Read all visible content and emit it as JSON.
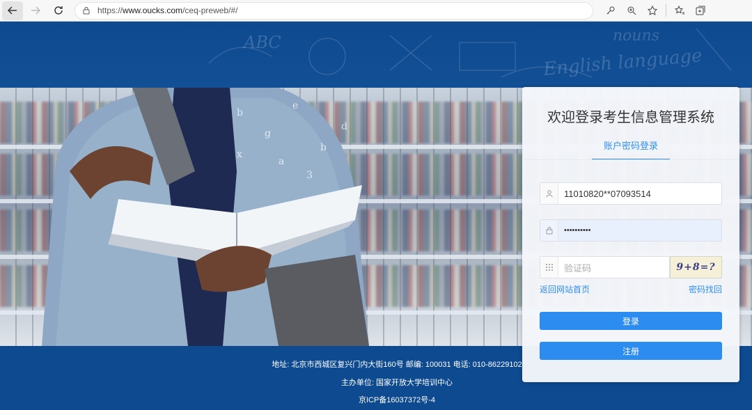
{
  "browser": {
    "url_prefix": "https://",
    "url_host": "www.oucks.com",
    "url_path": "/ceq-preweb/#/"
  },
  "background": {
    "chalk_text_1": "ABC",
    "chalk_text_2": "English language",
    "chalk_text_3": "nouns"
  },
  "login": {
    "title": "欢迎登录考生信息管理系统",
    "tab_label": "账户密码登录",
    "username_value": "11010820**07093514",
    "password_value": "••••••••••",
    "captcha_placeholder": "验证码",
    "captcha_image_text": "9+8=?",
    "back_home_link": "返回网站首页",
    "recover_password_link": "密码找回",
    "login_button": "登录",
    "register_button": "注册"
  },
  "footer": {
    "address_line": "地址: 北京市西城区复兴门内大街160号 邮编: 100031 电话: 010-86229102",
    "host_line": "主办单位: 国家开放大学培训中心",
    "icp_line": "京ICP备16037372号-4"
  },
  "colors": {
    "brand_blue": "#0e4a8f",
    "accent": "#2d8cf0"
  }
}
